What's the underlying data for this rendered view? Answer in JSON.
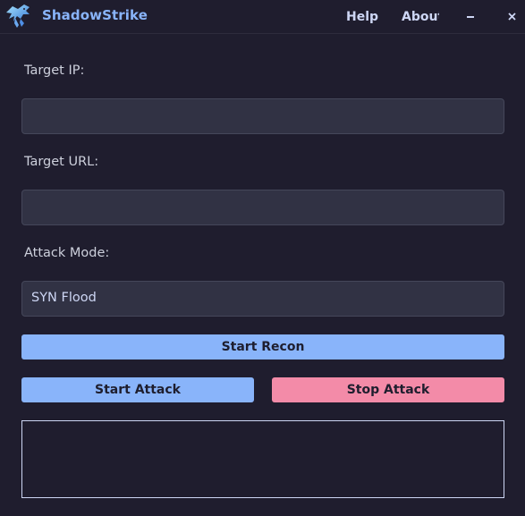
{
  "app": {
    "title": "ShadowStrike",
    "logo_icon": "hawk-logo-icon"
  },
  "menu": {
    "help": "Help",
    "about": "About"
  },
  "window_controls": {
    "minimize": "minimize-icon",
    "close": "close-icon"
  },
  "form": {
    "target_ip": {
      "label": "Target IP:",
      "value": "",
      "placeholder": ""
    },
    "target_url": {
      "label": "Target URL:",
      "value": "",
      "placeholder": ""
    },
    "attack_mode": {
      "label": "Attack Mode:",
      "selected": "SYN Flood"
    }
  },
  "buttons": {
    "start_recon": "Start Recon",
    "start_attack": "Start Attack",
    "stop_attack": "Stop Attack"
  },
  "log": {
    "content": ""
  },
  "colors": {
    "background": "#1f1d2e",
    "accent_blue": "#89b4fa",
    "accent_pink": "#f38ba8",
    "input_bg": "#313244"
  }
}
